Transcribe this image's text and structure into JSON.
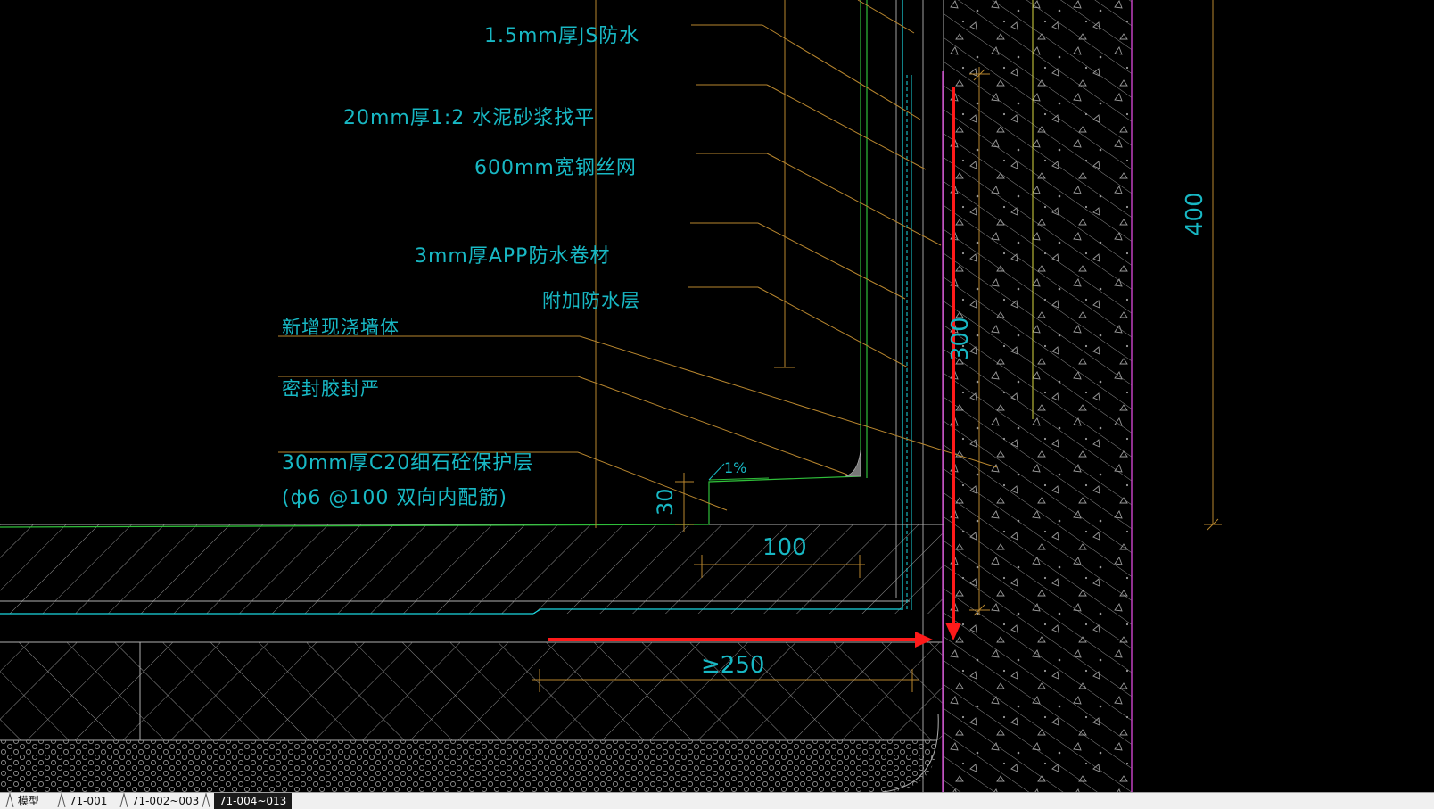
{
  "annotations": {
    "js_waterproof": "1.5mm厚JS防水",
    "cement_mortar": "20mm厚1:2 水泥砂浆找平",
    "steel_mesh": "600mm宽钢丝网",
    "app_membrane": "3mm厚APP防水卷材",
    "additional_layer": "附加防水层",
    "new_wall": "新增现浇墙体",
    "sealant": "密封胶封严",
    "protective_layer_1": "30mm厚C20细石砼保护层",
    "protective_layer_2": "(ф6 @100 双向内配筋)"
  },
  "dimensions": {
    "dim_400": "400",
    "dim_300": "300",
    "dim_30": "30",
    "dim_100": "100",
    "dim_250": "≥250",
    "slope": "1%"
  },
  "colors": {
    "background": "#000000",
    "text": "#18b8c4",
    "leader": "#b8862e",
    "green_line": "#2fbf3a",
    "cyan_line": "#1ad7e0",
    "magenta_line": "#c040c0",
    "yellow_line": "#d8d840",
    "hatch": "#9a9a9a",
    "arrow": "#ff1a1a"
  },
  "tabs": {
    "model": "模型",
    "tab1": "71-001",
    "tab2": "71-002~003",
    "tab3": "71-004~013",
    "active": "71-004~013"
  }
}
